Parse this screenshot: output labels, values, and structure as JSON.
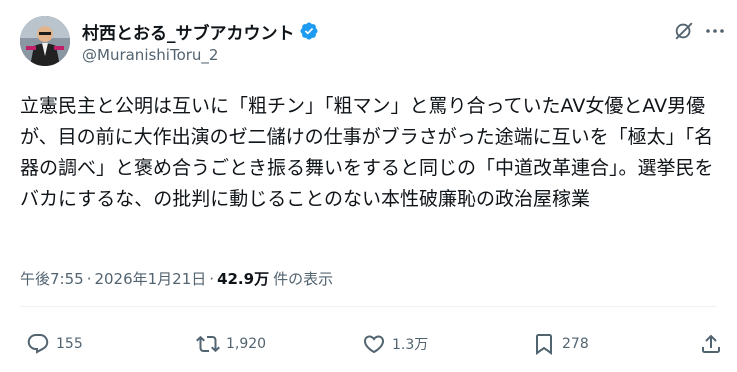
{
  "author": {
    "display_name": "村西とおる_サブアカウント",
    "handle": "@MuranishiToru_2",
    "verified": true,
    "verified_color": "#1d9bf0"
  },
  "header_icons": [
    "grok-icon",
    "more-icon"
  ],
  "post": {
    "text": "立憲民主と公明は互いに「粗チン」「粗マン」と罵り合っていたAV女優とAV男優が、目の前に大作出演のゼ二儲けの仕事がブラさがった途端に互いを「極太」「名器の調べ」と褒め合うごとき振る舞いをすると同じの「中道改革連合」。選挙民をバカにするな、の批判に動じることのない本性破廉恥の政治屋稼業"
  },
  "meta": {
    "time": "午後7:55",
    "separator": "·",
    "date": "2026年1月21日",
    "views_count": "42.9万",
    "views_label": "件の表示"
  },
  "actions": {
    "reply_count": "155",
    "retweet_count": "1,920",
    "like_count": "1.3万",
    "bookmark_count": "278"
  },
  "colors": {
    "text_primary": "#0f1419",
    "text_secondary": "#536471",
    "divider": "#eff3f4"
  }
}
